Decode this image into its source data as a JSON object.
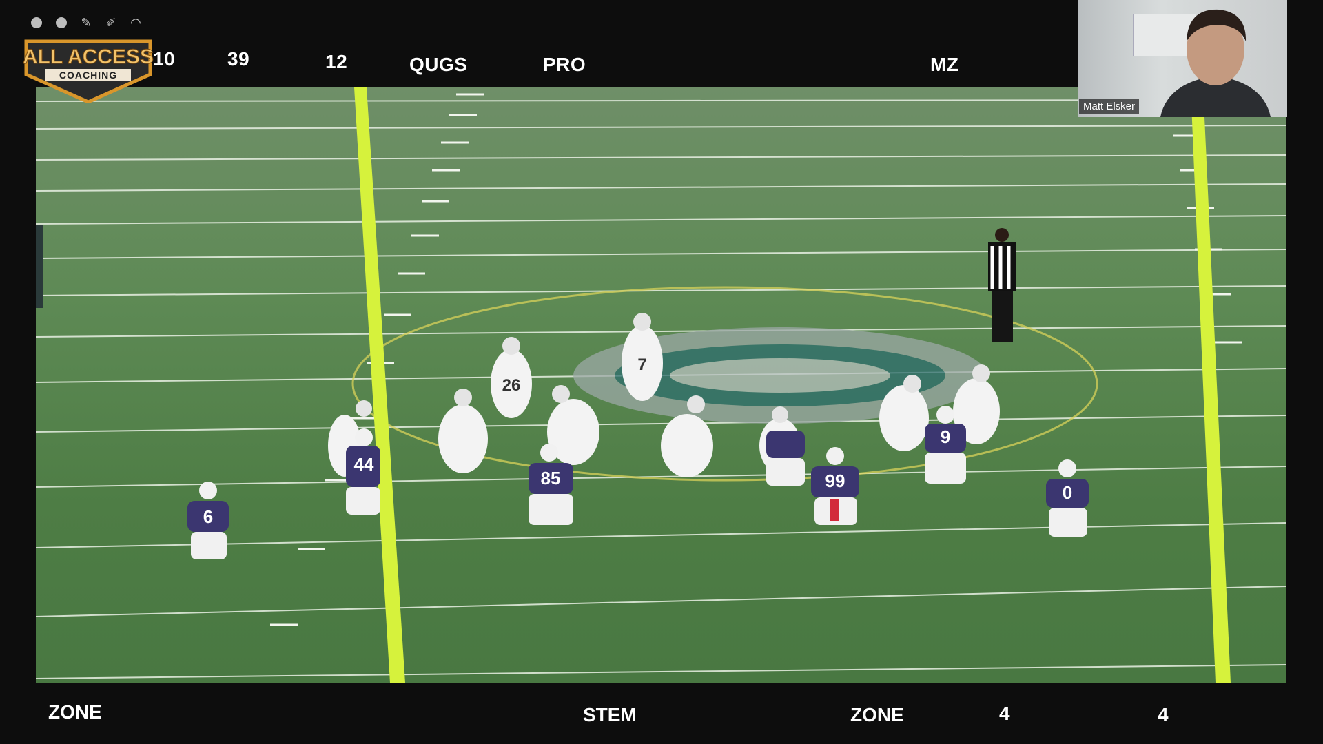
{
  "toolbar": {
    "tools": [
      {
        "icon": "circle-tool-icon"
      },
      {
        "icon": "circle-filled-tool-icon"
      },
      {
        "icon": "pencil-tool-icon"
      },
      {
        "icon": "marker-tool-icon"
      },
      {
        "icon": "helmet-tool-icon"
      }
    ]
  },
  "logo": {
    "line1": "ALL ACCESS",
    "line2": "COACHING"
  },
  "top_bar": {
    "value1": "10",
    "value2": "39",
    "value3": "12",
    "formation": "QUGS",
    "personnel": "PRO",
    "tag": "MZ"
  },
  "bottom_bar": {
    "coverage": "ZONE",
    "front": "STEM",
    "pressure": "ZONE",
    "count1": "4",
    "count2": "4"
  },
  "webcam": {
    "participant_name": "Matt Elsker"
  },
  "jerseys": {
    "defense": [
      "6",
      "44",
      "85",
      "99",
      "9",
      "0"
    ],
    "offense": [
      "7",
      "26"
    ]
  },
  "colors": {
    "field_green": "#5e8a55",
    "yard_marker_yellow": "#d6f23c",
    "defense_jersey": "#3b3670",
    "logo_gold": "#d9962b"
  }
}
